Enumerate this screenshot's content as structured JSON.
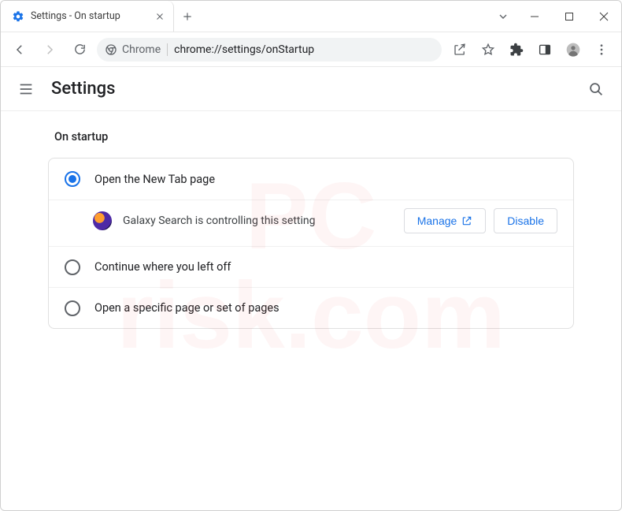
{
  "tab": {
    "title": "Settings - On startup"
  },
  "omnibox": {
    "chip": "Chrome",
    "url": "chrome://settings/onStartup"
  },
  "header": {
    "title": "Settings"
  },
  "section": {
    "label": "On startup"
  },
  "options": {
    "opt1": "Open the New Tab page",
    "opt2": "Continue where you left off",
    "opt3": "Open a specific page or set of pages"
  },
  "extension": {
    "message": "Galaxy Search is controlling this setting",
    "manage": "Manage",
    "disable": "Disable"
  },
  "watermark": {
    "line1": "PC",
    "line2": "risk.com"
  }
}
